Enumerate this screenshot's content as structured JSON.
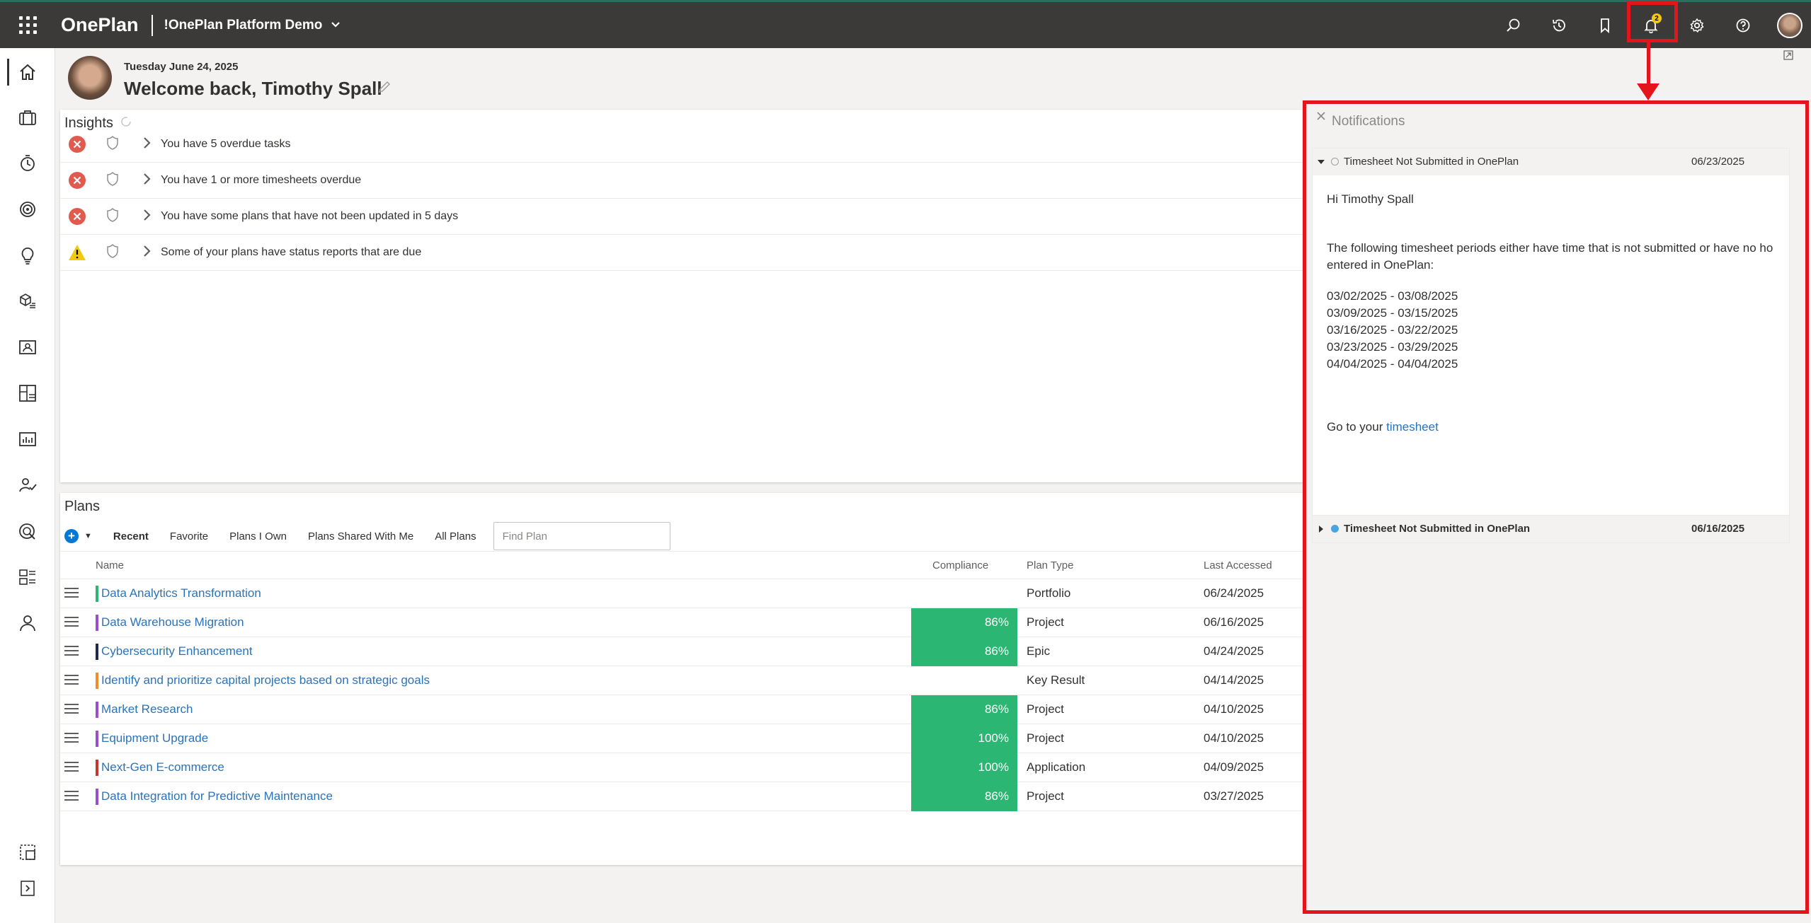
{
  "app": {
    "brand": "OnePlan",
    "workspace": "!OnePlan Platform Demo"
  },
  "topbar": {
    "icons": [
      "search-icon",
      "history-icon",
      "bookmark-icon",
      "bell-icon",
      "gear-icon",
      "help-icon"
    ],
    "notification_count": "2"
  },
  "leftrail": {
    "icons": [
      "home-icon",
      "briefcase-icon",
      "timer-icon",
      "target-icon",
      "lightbulb-icon",
      "cube-list-icon",
      "person-card-icon",
      "board-icon",
      "report-icon",
      "people-check-icon",
      "radar-icon",
      "hierarchy-icon",
      "person-icon",
      "selection-icon",
      "expand-icon"
    ]
  },
  "header": {
    "date": "Tuesday June 24, 2025",
    "welcome": "Welcome back, Timothy Spall"
  },
  "insights": {
    "title": "Insights",
    "rows": [
      {
        "status": "error",
        "text": "You have 5 overdue tasks"
      },
      {
        "status": "error",
        "text": "You have 1 or more timesheets overdue"
      },
      {
        "status": "error",
        "text": "You have some plans that have not been updated in 5 days"
      },
      {
        "status": "warning",
        "text": "Some of your plans have status reports that are due"
      }
    ]
  },
  "plans": {
    "title": "Plans",
    "tabs": [
      "Recent",
      "Favorite",
      "Plans I Own",
      "Plans Shared With Me",
      "All Plans"
    ],
    "active_tab": "Recent",
    "search_placeholder": "Find Plan",
    "columns": {
      "name": "Name",
      "compliance": "Compliance",
      "plan_type": "Plan Type",
      "last_accessed": "Last Accessed"
    },
    "rows": [
      {
        "name": "Data Analytics Transformation",
        "color": "#2bb673",
        "compliance": "",
        "type": "Portfolio",
        "accessed": "06/24/2025"
      },
      {
        "name": "Data Warehouse Migration",
        "color": "#9b4dca",
        "compliance": "86%",
        "type": "Project",
        "accessed": "06/16/2025"
      },
      {
        "name": "Cybersecurity Enhancement",
        "color": "#1f2a44",
        "compliance": "86%",
        "type": "Epic",
        "accessed": "04/24/2025"
      },
      {
        "name": "Identify and prioritize capital projects based on strategic goals",
        "color": "#f28c28",
        "compliance": "",
        "type": "Key Result",
        "accessed": "04/14/2025"
      },
      {
        "name": "Market Research",
        "color": "#9b4dca",
        "compliance": "86%",
        "type": "Project",
        "accessed": "04/10/2025"
      },
      {
        "name": "Equipment Upgrade",
        "color": "#9b4dca",
        "compliance": "100%",
        "type": "Project",
        "accessed": "04/10/2025"
      },
      {
        "name": "Next-Gen E-commerce",
        "color": "#c0392b",
        "compliance": "100%",
        "type": "Application",
        "accessed": "04/09/2025"
      },
      {
        "name": "Data Integration for Predictive Maintenance",
        "color": "#9b4dca",
        "compliance": "86%",
        "type": "Project",
        "accessed": "03/27/2025"
      }
    ]
  },
  "notifications": {
    "title": "Notifications",
    "items": [
      {
        "title": "Timesheet Not Submitted in OnePlan",
        "date": "06/23/2025",
        "read": true,
        "expanded": true,
        "greeting": "Hi Timothy Spall",
        "message_line1": "The following timesheet periods either have time that is not submitted or have no ho",
        "message_line2": "entered in OnePlan:",
        "periods": [
          "03/02/2025 - 03/08/2025",
          "03/09/2025 - 03/15/2025",
          "03/16/2025 - 03/22/2025",
          "03/23/2025 - 03/29/2025",
          "04/04/2025 - 04/04/2025"
        ],
        "goto_text": "Go to your",
        "goto_link": "timesheet"
      },
      {
        "title": "Timesheet Not Submitted in OnePlan",
        "date": "06/16/2025",
        "read": false,
        "expanded": false
      }
    ]
  },
  "colors": {
    "topbar": "#3b3a39",
    "accent": "#0078d4",
    "compliance_green": "#2bb673",
    "error_red": "#e05a4f",
    "warning_yellow": "#f2c811",
    "highlight_red": "#e3141b",
    "unread_dot": "#4ba3e0"
  }
}
